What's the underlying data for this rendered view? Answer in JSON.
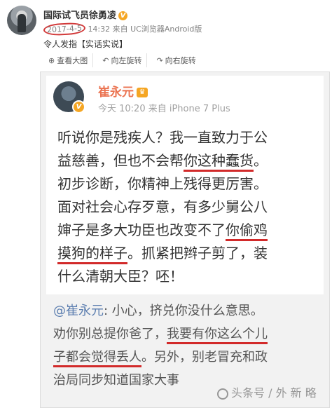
{
  "outer_post": {
    "username": "国际试飞员徐勇凌",
    "verified_badge": "V",
    "date": "2017-4-5",
    "meta_rest": "14:32 来自 UC浏览器Android版",
    "body": "令人发指【实话实说】",
    "toolbar": [
      {
        "icon": "zoom-in-icon",
        "glyph": "⊕",
        "label": "查看大图"
      },
      {
        "icon": "rotate-left-icon",
        "glyph": "↶",
        "label": "向左旋转"
      },
      {
        "icon": "rotate-right-icon",
        "glyph": "↷",
        "label": "向右旋转"
      }
    ]
  },
  "inner_post": {
    "username": "崔永元",
    "meta": "今天 10:20 来自 iPhone 7 Plus",
    "lines": [
      {
        "a": "听说你是残疾人？我一直致力于公",
        "u": "",
        "b": ""
      },
      {
        "a": "益慈善，但也不会帮",
        "u": "你这种蠢货",
        "b": "。"
      },
      {
        "a": "初步诊断，你精神上残得更厉害。",
        "u": "",
        "b": ""
      },
      {
        "a": "面对社会心存歹意，有多少舅公八",
        "u": "",
        "b": ""
      },
      {
        "a": "婶子是多大功臣也改变不了",
        "u": "你偷鸡",
        "b": ""
      },
      {
        "a": "",
        "u": "摸狗的样子",
        "b": "。抓紧把辫子剪了，装"
      },
      {
        "a": "什么清朝大臣？呸！",
        "u": "",
        "b": ""
      }
    ]
  },
  "comment": {
    "mention": "@崔永元",
    "lines": [
      {
        "a": ": 小心，挤兑你没什么意思。",
        "u": "",
        "b": ""
      },
      {
        "a": "劝你别总提你爸了，",
        "u": "我要有你这么个儿",
        "b": ""
      },
      {
        "a": "",
        "u": "子都会觉得丢人",
        "b": "。另外，别老冒充和政"
      },
      {
        "a": "治局同步知道国家大事",
        "u": "",
        "b": ""
      }
    ]
  },
  "watermark": "头条号 / 外 新 略"
}
